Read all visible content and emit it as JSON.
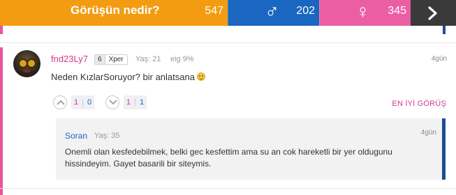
{
  "topbar": {
    "title": "Görüşün nedir?",
    "total_count": "547",
    "male_symbol": "♂",
    "male_count": "202",
    "female_symbol": "♀",
    "female_count": "345",
    "next_icon": "chevron-right-icon",
    "colors": {
      "opinion": "#f39c12",
      "male": "#1a66c0",
      "female": "#ec5ea3",
      "next": "#3a3a3a"
    }
  },
  "comment": {
    "username": "fnd23Ly7",
    "level_number": "6",
    "level_label": "Xper",
    "age": "Yaş: 21",
    "match": "eig 9%",
    "time": "4gün",
    "text": "Neden KızlarSoruyor? bir anlatsana",
    "upvotes": {
      "female": "1",
      "male": "0"
    },
    "downvotes": {
      "female": "1",
      "male": "1"
    },
    "best_label": "EN İYİ GÖRÜŞ"
  },
  "reply": {
    "username": "Soran",
    "age": "Yaş: 35",
    "time": "4gün",
    "text": "Onemli olan kesfedebilmek, belki gec kesfettim ama su an cok hareketli bir yer oldugunu hissindeyim. Gayet basarili bir siteymis."
  }
}
